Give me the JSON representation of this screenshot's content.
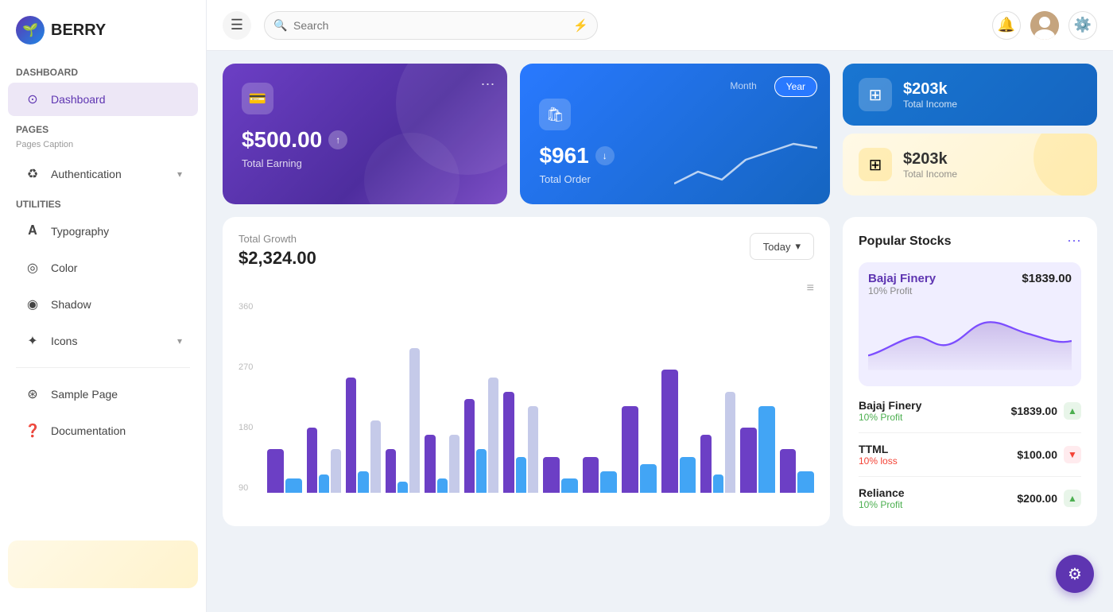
{
  "app": {
    "name": "BERRY",
    "logo_char": "🌱"
  },
  "header": {
    "menu_icon": "☰",
    "search_placeholder": "Search",
    "filter_icon": "⚡",
    "bell_icon": "🔔",
    "settings_icon": "⚙️"
  },
  "sidebar": {
    "section_dashboard": "Dashboard",
    "item_dashboard": "Dashboard",
    "section_pages": "Pages",
    "section_pages_caption": "Pages Caption",
    "item_authentication": "Authentication",
    "section_utilities": "Utilities",
    "item_typography": "Typography",
    "item_color": "Color",
    "item_shadow": "Shadow",
    "item_icons": "Icons",
    "item_sample_page": "Sample Page",
    "item_documentation": "Documentation"
  },
  "earning_card": {
    "amount": "$500.00",
    "label": "Total Earning",
    "more_icon": "⋯"
  },
  "order_card": {
    "amount": "$961",
    "label": "Total Order",
    "tab_month": "Month",
    "tab_year": "Year"
  },
  "income_card_blue": {
    "amount": "$203k",
    "label": "Total Income"
  },
  "income_card_yellow": {
    "amount": "$203k",
    "label": "Total Income"
  },
  "total_growth": {
    "label": "Total Growth",
    "amount": "$2,324.00",
    "btn_today": "Today",
    "y_labels": [
      "360",
      "270",
      "180",
      "90"
    ],
    "bars": [
      {
        "purple": 60,
        "blue": 20,
        "light": 0
      },
      {
        "purple": 90,
        "blue": 25,
        "light": 60
      },
      {
        "purple": 160,
        "blue": 30,
        "light": 100
      },
      {
        "purple": 60,
        "blue": 15,
        "light": 200
      },
      {
        "purple": 80,
        "blue": 20,
        "light": 80
      },
      {
        "purple": 130,
        "blue": 60,
        "light": 160
      },
      {
        "purple": 140,
        "blue": 50,
        "light": 120
      },
      {
        "purple": 50,
        "blue": 20,
        "light": 0
      },
      {
        "purple": 50,
        "blue": 30,
        "light": 0
      },
      {
        "purple": 120,
        "blue": 40,
        "light": 0
      },
      {
        "purple": 170,
        "blue": 50,
        "light": 0
      },
      {
        "purple": 80,
        "blue": 25,
        "light": 140
      },
      {
        "purple": 90,
        "blue": 120,
        "light": 0
      },
      {
        "purple": 60,
        "blue": 30,
        "light": 0
      }
    ]
  },
  "popular_stocks": {
    "title": "Popular Stocks",
    "more_icon": "⋯",
    "featured": {
      "name": "Bajaj Finery",
      "price": "$1839.00",
      "profit_label": "10% Profit"
    },
    "list": [
      {
        "name": "Bajaj Finery",
        "profit": "10% Profit",
        "profit_type": "up",
        "price": "$1839.00",
        "arrow": "up"
      },
      {
        "name": "TTML",
        "profit": "10% loss",
        "profit_type": "down",
        "price": "$100.00",
        "arrow": "down"
      },
      {
        "name": "Reliance",
        "profit": "10% Profit",
        "profit_type": "up",
        "price": "$200.00",
        "arrow": "up"
      }
    ]
  },
  "colors": {
    "purple_primary": "#5e35b1",
    "blue_primary": "#1976d2",
    "accent_yellow": "#ffc107",
    "bar_purple": "#6c3fc5",
    "bar_blue": "#42a5f5",
    "bar_light": "#c5cae9"
  }
}
